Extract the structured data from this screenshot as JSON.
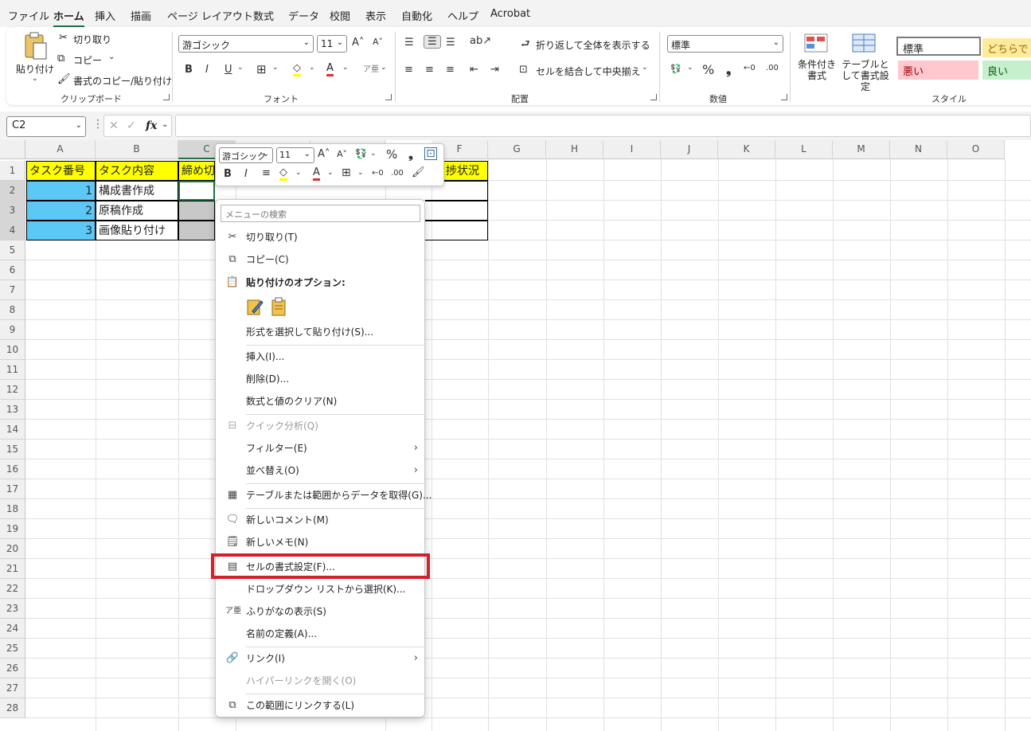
{
  "menu_tabs": [
    "ファイル",
    "ホーム",
    "挿入",
    "描画",
    "ページ レイアウト",
    "数式",
    "データ",
    "校閲",
    "表示",
    "自動化",
    "ヘルプ",
    "Acrobat"
  ],
  "ribbon": {
    "clipboard": {
      "paste": "貼り付け",
      "cut": "切り取り",
      "copy": "コピー",
      "format_painter": "書式のコピー/貼り付け",
      "group": "クリップボード"
    },
    "font": {
      "name": "游ゴシック",
      "size": "11",
      "group": "フォント"
    },
    "alignment": {
      "wrap": "折り返して全体を表示する",
      "merge": "セルを結合して中央揃え",
      "group": "配置"
    },
    "number": {
      "format": "標準",
      "group": "数値"
    },
    "styles": {
      "conditional": "条件付き書式",
      "table": "テーブルとして書式設定",
      "group": "スタイル",
      "normal": "標準",
      "neutral": "どちらで",
      "bad": "悪い",
      "good": "良い"
    }
  },
  "name_box": "C2",
  "fx_label": "fx",
  "columns": [
    "A",
    "B",
    "C",
    "D",
    "E",
    "F",
    "G",
    "H",
    "I",
    "J",
    "K",
    "L",
    "M",
    "N",
    "O"
  ],
  "rows": [
    "1",
    "2",
    "3",
    "4",
    "5",
    "6",
    "7",
    "8",
    "9",
    "10",
    "11",
    "12",
    "13",
    "14",
    "15",
    "16",
    "17",
    "18",
    "19",
    "20",
    "21",
    "22",
    "23",
    "24",
    "25",
    "26",
    "27",
    "28"
  ],
  "cells": {
    "a1": "タスク番号",
    "b1": "タスク内容",
    "c1": "締め切",
    "f1": "捗状況",
    "a2": "1",
    "b2": "構成書作成",
    "a3": "2",
    "b3": "原稿作成",
    "a4": "3",
    "b4": "画像貼り付け"
  },
  "mini_toolbar": {
    "font": "游ゴシック",
    "size": "11"
  },
  "context_menu": {
    "search_placeholder": "メニューの検索",
    "cut": "切り取り(T)",
    "copy": "コピー(C)",
    "paste_options": "貼り付けのオプション:",
    "paste_special": "形式を選択して貼り付け(S)...",
    "insert": "挿入(I)...",
    "delete": "削除(D)...",
    "clear": "数式と値のクリア(N)",
    "quick_analysis": "クイック分析(Q)",
    "filter": "フィルター(E)",
    "sort": "並べ替え(O)",
    "get_data": "テーブルまたは範囲からデータを取得(G)...",
    "new_comment": "新しいコメント(M)",
    "new_note": "新しいメモ(N)",
    "format_cells": "セルの書式設定(F)...",
    "dropdown": "ドロップダウン リストから選択(K)...",
    "phonetic": "ふりがなの表示(S)",
    "define_name": "名前の定義(A)...",
    "link": "リンク(I)",
    "open_hyperlink": "ハイパーリンクを開く(O)",
    "link_to_range": "この範囲にリンクする(L)"
  },
  "colors": {
    "header_yellow": "#ffff00",
    "cell_blue": "#5bc8f5",
    "cell_gray": "#c8c8c8",
    "highlight_red": "#d3212c",
    "accent_green": "#1e7145"
  }
}
